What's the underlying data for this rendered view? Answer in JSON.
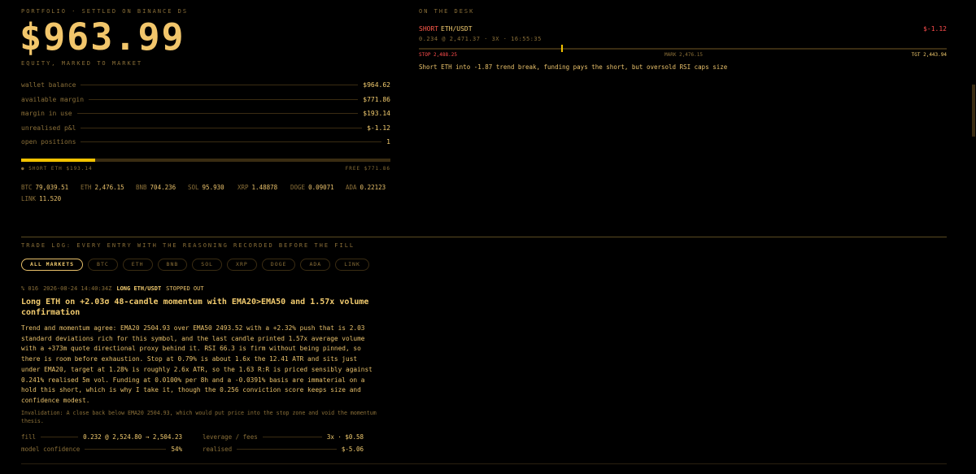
{
  "portfolio": {
    "label": "PORTFOLIO · SETTLED ON BINANCE DS",
    "equity": "$963.99",
    "equity_caption": "EQUITY, MARKED TO MARKET",
    "rows": [
      {
        "key": "wallet balance",
        "value": "$964.62"
      },
      {
        "key": "available margin",
        "value": "$771.86"
      },
      {
        "key": "margin in use",
        "value": "$193.14"
      },
      {
        "key": "unrealised p&l",
        "value": "$-1.12"
      },
      {
        "key": "open positions",
        "value": "1"
      }
    ],
    "margin_used_fraction": 0.2,
    "bar_left": "● SHORT ETH $193.14",
    "bar_right": "FREE $771.86"
  },
  "tickers": [
    {
      "symbol": "BTC",
      "price": "79,039.51"
    },
    {
      "symbol": "ETH",
      "price": "2,476.15"
    },
    {
      "symbol": "BNB",
      "price": "704.236"
    },
    {
      "symbol": "SOL",
      "price": "95.930"
    },
    {
      "symbol": "XRP",
      "price": "1.48878"
    },
    {
      "symbol": "DOGE",
      "price": "0.09071"
    },
    {
      "symbol": "ADA",
      "price": "0.22123"
    },
    {
      "symbol": "LINK",
      "price": "11.520"
    }
  ],
  "desk": {
    "label": "ON THE DESK",
    "position": {
      "side": "SHORT",
      "symbol": "ETH/USDT",
      "pnl": "$-1.12",
      "meta": "0.234 @ 2,471.37 · 3X · 16:55:35",
      "stop": "STOP 2,488.25",
      "mark": "MARK 2,476.15",
      "target": "TGT 2,443.94",
      "marker_fraction": 0.27,
      "thesis": "Short ETH into -1.87 trend break, funding pays the short, but oversold RSI caps size"
    }
  },
  "log": {
    "label": "TRADE LOG: EVERY ENTRY WITH THE REASONING RECORDED BEFORE THE FILL",
    "filters": [
      "ALL MARKETS",
      "BTC",
      "ETH",
      "BNB",
      "SOL",
      "XRP",
      "DOGE",
      "ADA",
      "LINK"
    ],
    "active_filter": "ALL MARKETS",
    "entry": {
      "id": "% 016",
      "timestamp": "2026-08-24 14:40:34Z",
      "market": "LONG ETH/USDT",
      "status": "STOPPED OUT",
      "title": "Long ETH on +2.03σ 48-candle momentum with EMA20>EMA50 and 1.57x volume confirmation",
      "body": "Trend and momentum agree: EMA20 2504.93 over EMA50 2493.52 with a +2.32% push that is 2.03 standard deviations rich for this symbol, and the last candle printed 1.57x average volume with a +373m quote directional proxy behind it. RSI 66.3 is firm without being pinned, so there is room before exhaustion. Stop at 0.79% is about 1.6x the 12.41 ATR and sits just under EMA20, target at 1.28% is roughly 2.6x ATR, so the 1.63 R:R is priced sensibly against 0.241% realised 5m vol. Funding at 0.0100% per 8h and a -0.0391% basis are immaterial on a hold this short, which is why I take it, though the 0.256 conviction score keeps size and confidence modest.",
      "invalidation": "Invalidation: A close back below EMA20 2504.93, which would put price into the stop zone and void the momentum thesis.",
      "fill_label": "fill",
      "fill_value": "0.232 @ 2,524.80 → 2,504.23",
      "confidence_label": "model confidence",
      "confidence_value": "54%",
      "leverage_label": "leverage / fees",
      "leverage_value": "3x · $0.58",
      "realised_label": "realised",
      "realised_value": "$-5.06"
    }
  },
  "colors": {
    "background": "#000000",
    "gold": "#e8c06a",
    "dim": "#8a6f38",
    "accent_bar": "#f2c200",
    "negative": "#ff4d4d"
  }
}
